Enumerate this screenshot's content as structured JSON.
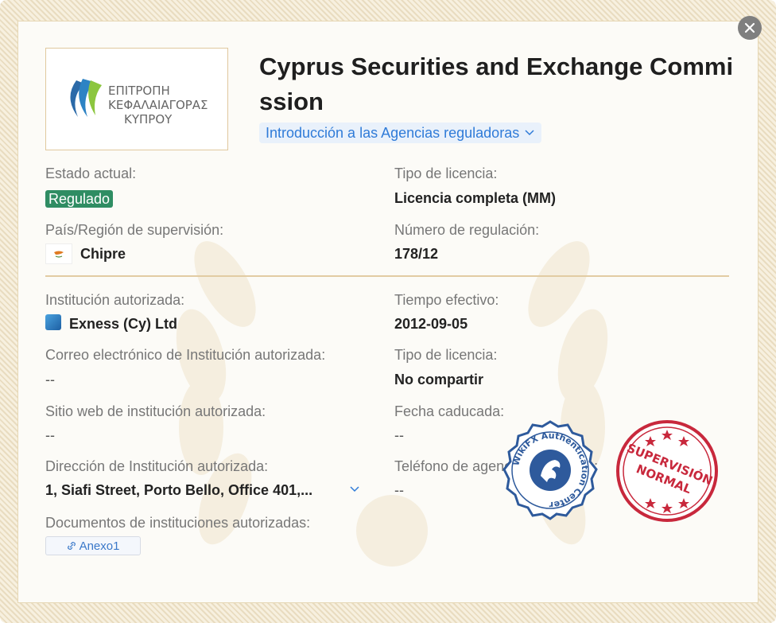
{
  "logo": {
    "line1": "ΕΠΙΤΡΟΠΗ",
    "line2": "ΚΕΦΑΛΑΙΑΓΟΡΑΣ",
    "line3": "ΚΥΠΡΟΥ"
  },
  "header": {
    "title": "Cyprus Securities and Exchange Commission",
    "agency_link": "Introducción a las Agencias reguladoras"
  },
  "fields": {
    "estado_label": "Estado actual:",
    "estado_value": "Regulado",
    "tipo_licencia_label": "Tipo de licencia:",
    "tipo_licencia_value": "Licencia completa (MM)",
    "pais_label": "País/Región de supervisión:",
    "pais_value": "Chipre",
    "numero_label": "Número de regulación:",
    "numero_value": "178/12",
    "institucion_label": "Institución autorizada:",
    "institucion_value": "Exness (Cy) Ltd",
    "tiempo_label": "Tiempo efectivo:",
    "tiempo_value": "2012-09-05",
    "correo_label": "Correo electrónico de Institución autorizada:",
    "correo_value": "--",
    "tipo_licencia2_label": "Tipo de licencia:",
    "tipo_licencia2_value": "No compartir",
    "sitio_label": "Sitio web de institución autorizada:",
    "sitio_value": "--",
    "fecha_label": "Fecha caducada:",
    "fecha_value": "--",
    "direccion_label": "Dirección de Institución autorizada:",
    "direccion_value": "1, Siafi Street, Porto Bello, Office 401,...",
    "telefono_label": "Teléfono de agencia de licencia:",
    "telefono_value": "--",
    "documentos_label": "Documentos de instituciones autorizadas:",
    "annex_label": "Anexo1"
  },
  "stamps": {
    "wikifx_text": "WikiFX Authentication Center",
    "supervision_line1": "SUPERVISIÓN",
    "supervision_line2": "NORMAL"
  },
  "colors": {
    "badge_green": "#2f8d63",
    "link_blue": "#2f7bd8",
    "stamp_blue": "#2e5a9c",
    "stamp_red": "#c8283c",
    "gold_border": "#e2cca3"
  }
}
